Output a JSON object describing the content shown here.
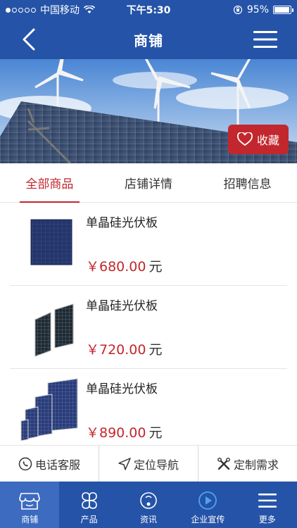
{
  "status_bar": {
    "carrier": "中国移动",
    "time": "下午5:30",
    "battery": "95%",
    "battery_level": 0.95
  },
  "header": {
    "title": "商铺",
    "back_icon": "chevron-left-icon",
    "menu_icon": "hamburger-menu-icon"
  },
  "banner": {
    "favorite_label": "收藏",
    "favorite_icon": "heart-icon"
  },
  "tabs": [
    {
      "label": "全部商品",
      "active": true
    },
    {
      "label": "店铺详情",
      "active": false
    },
    {
      "label": "招聘信息",
      "active": false
    }
  ],
  "products": [
    {
      "name": "单晶硅光伏板",
      "price": "￥680.00",
      "unit": "元"
    },
    {
      "name": "单晶硅光伏板",
      "price": "￥720.00",
      "unit": "元"
    },
    {
      "name": "单晶硅光伏板",
      "price": "￥890.00",
      "unit": "元"
    }
  ],
  "actions": [
    {
      "label": "电话客服",
      "icon": "phone-icon"
    },
    {
      "label": "定位导航",
      "icon": "navigation-arrow-icon"
    },
    {
      "label": "定制需求",
      "icon": "tools-icon"
    }
  ],
  "bottom_nav": [
    {
      "label": "商铺",
      "icon": "store-icon",
      "active": true
    },
    {
      "label": "产品",
      "icon": "clover-icon",
      "active": false
    },
    {
      "label": "资讯",
      "icon": "news-icon",
      "active": false
    },
    {
      "label": "企业宣传",
      "icon": "play-icon",
      "active": false
    },
    {
      "label": "更多",
      "icon": "more-menu-icon",
      "active": false
    }
  ],
  "colors": {
    "primary": "#2553a8",
    "accent": "#c2272d"
  }
}
